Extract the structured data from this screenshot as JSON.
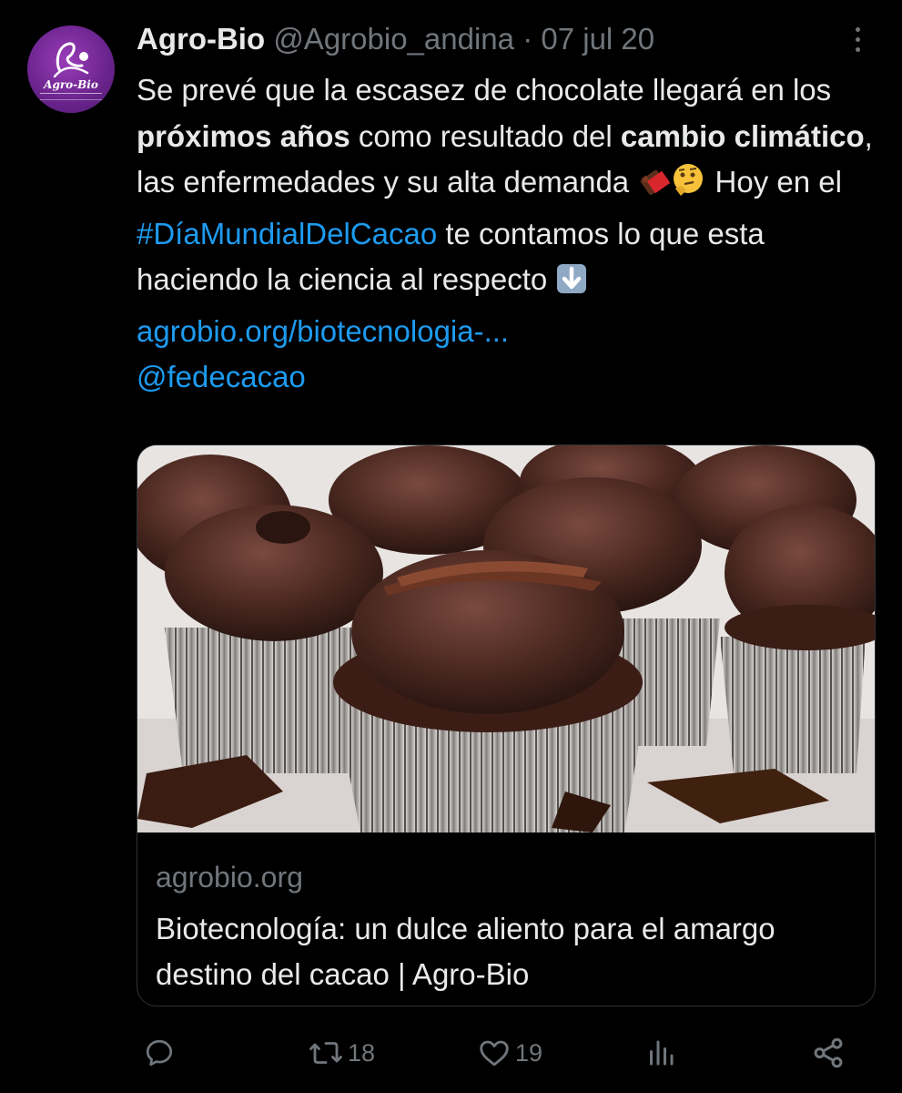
{
  "author": {
    "name": "Agro-Bio",
    "handle": "@Agrobio_andina",
    "separator": "·",
    "date": "07 jul 20",
    "avatar_logo_text": "Agro-Bio"
  },
  "tweet": {
    "text_1": "Se prevé que la escasez de chocolate llegará en los ",
    "bold_1": "próximos años",
    "text_2": " como resultado del ",
    "bold_2": "cambio climático",
    "text_3": ", las enfermedades y su alta demanda ",
    "emoji_1": "chocolate-bar-emoji",
    "emoji_2": "thinking-face-emoji",
    "text_4": " Hoy en el ",
    "hashtag": "#DíaMundialDelCacao",
    "text_5": " te contamos lo que esta haciendo la ciencia al respecto ",
    "emoji_3": "down-arrow-emoji",
    "url": "agrobio.org/biotecnologia-...",
    "mention": "@fedecacao"
  },
  "card": {
    "image_description_icon": "chocolate-cupcakes-photo",
    "domain": "agrobio.org",
    "title": "Biotecnología: un dulce aliento para el amargo destino del cacao | Agro-Bio"
  },
  "actions": {
    "reply_count": "",
    "retweet_count": "18",
    "like_count": "19",
    "views_count": "",
    "icons": [
      "reply-icon",
      "retweet-icon",
      "like-icon",
      "views-icon",
      "share-icon"
    ]
  },
  "colors": {
    "background": "#000000",
    "text": "#e7e9ea",
    "muted": "#71767b",
    "link": "#1d9bf0",
    "avatar": "#6d2590"
  }
}
